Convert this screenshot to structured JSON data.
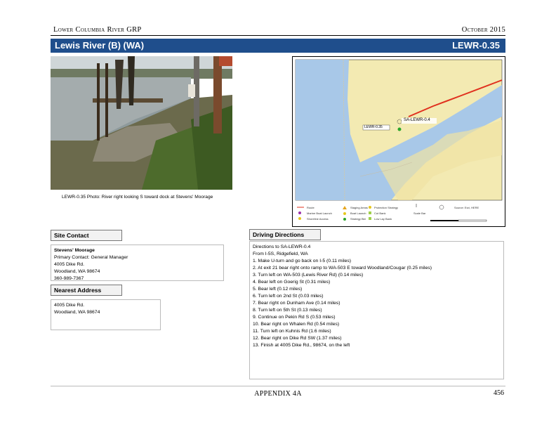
{
  "header": {
    "left": "Lower Columbia River GRP",
    "right": "October 2015"
  },
  "title": {
    "left": "Lewis River (B) (WA)",
    "right": "LEWR-0.35"
  },
  "photo_caption": "LEWR-0.35  Photo: River right looking S toward dock at Stevens' Moorage",
  "map": {
    "site_label": "LEWR-0.35",
    "staging_label": "SA-LEWR-0.4",
    "legend": [
      "Route",
      "Marine Boat Launch",
      "Shoreline Access",
      "Staging Areas",
      "Boat Launch",
      "Strategy Bkt",
      "Protection Strategy",
      "Cut Bank",
      "Low Lay Bank",
      "Scale Bar",
      "Source: Esri, HERE"
    ],
    "colors": {
      "water": "#a8c8e8",
      "land": "#f3eab2",
      "route": "#e0301e"
    }
  },
  "site_contact": {
    "heading": "Site Contact",
    "lines": [
      "Stevens' Moorage",
      "Primary Contact: General Manager",
      "4005 Dike Rd.",
      "Woodland, WA 98674",
      "360-989-7367"
    ]
  },
  "nearest_address": {
    "heading": "Nearest Address",
    "lines": [
      "4005 Dike Rd.",
      "Woodland, WA  98674"
    ]
  },
  "driving_directions": {
    "heading": "Driving Directions",
    "lines": [
      "Directions to SA-LEWR-0.4",
      "From I-5S, Ridgefield, WA",
      "1. Make U-turn and go back on I-5 (0.11 miles)",
      "2. At exit 21 bear right onto ramp to WA-503 E toward Woodland/Cougar (0.25 miles)",
      "3. Turn left on WA-503 (Lewis River Rd)  (0.14 miles)",
      "4. Bear left on Goerig St (0.31 miles)",
      "5. Bear left (0.12 miles)",
      "6. Turn left on 2nd St (0.03 miles)",
      "7. Bear right on Dunham Ave  (0.14 miles)",
      "8. Turn left on 5th St (0.13 miles)",
      "9. Continue on Pekin Rd S (0.53 miles)",
      "10. Bear right on Whalen Rd  (0.54 miles)",
      "11. Turn left on Kuhnis Rd  (1.6 miles)",
      "12. Bear right on Dike Rd SW (1.37 miles)",
      "13. Finish at 4005 Dike Rd., 98674, on the left"
    ]
  },
  "footer": {
    "center": "APPENDIX 4A",
    "page": "456"
  }
}
